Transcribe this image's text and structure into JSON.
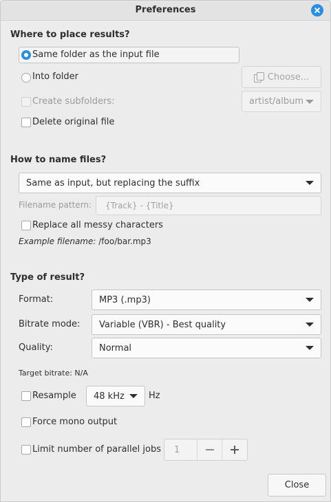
{
  "window": {
    "title": "Preferences"
  },
  "placement": {
    "heading": "Where to place results?",
    "same_folder_label": "Same folder as the input file",
    "into_folder_label": "Into folder",
    "choose_button": "Choose...",
    "create_subfolders_label": "Create subfolders:",
    "subfolder_pattern": "artist/album",
    "delete_original_label": "Delete original file"
  },
  "naming": {
    "heading": "How to name files?",
    "mode": "Same as input, but replacing the suffix",
    "pattern_label": "Filename pattern:",
    "pattern_placeholder": "{Track} - {Title}",
    "replace_messy_label": "Replace all messy characters",
    "example_label": "Example filename:",
    "example_value": "/foo/bar.mp3"
  },
  "result": {
    "heading": "Type of result?",
    "format_label": "Format:",
    "format_value": "MP3 (.mp3)",
    "bitrate_mode_label": "Bitrate mode:",
    "bitrate_mode_value": "Variable (VBR) - Best quality",
    "quality_label": "Quality:",
    "quality_value": "Normal",
    "target_bitrate": "Target bitrate: N/A",
    "resample_label": "Resample",
    "resample_rate": "48 kHz",
    "resample_unit": "Hz",
    "force_mono_label": "Force mono output",
    "limit_jobs_label": "Limit number of parallel jobs",
    "jobs_value": "1"
  },
  "footer": {
    "close_button": "Close"
  },
  "colors": {
    "accent": "#2b8ee0"
  }
}
